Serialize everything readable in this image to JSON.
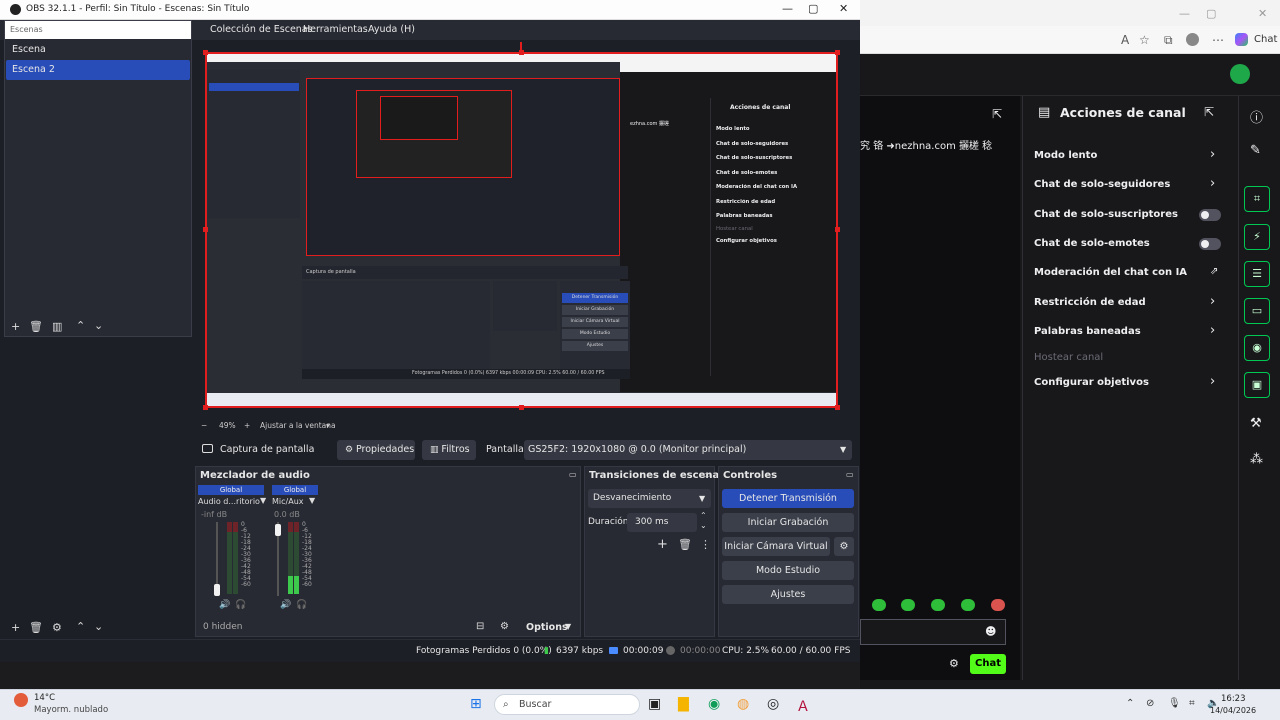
{
  "obs": {
    "title": "OBS 32.1.1 - Perfil: Sin Título - Escenas: Sin Título",
    "menu": [
      "Colección de Escenas",
      "Herramientas",
      "Ayuda (H)"
    ],
    "scenes_header": "Escenas",
    "scenes": [
      "Escena",
      "Escena 2"
    ],
    "zoom_level": "49%",
    "zoom_fit": "Ajustar a la ventana",
    "source_name": "Captura de pantalla",
    "properties_label": "Propiedades",
    "filters_label": "Filtros",
    "display_label": "Pantalla",
    "display_value": "GS25F2: 1920x1080 @ 0.0 (Monitor principal)",
    "mixer": {
      "title": "Mezclador de audio",
      "global_label": "Global",
      "channels": [
        {
          "name": "Audio d...ritorio",
          "db": "-inf dB"
        },
        {
          "name": "Mic/Aux",
          "db": "0.0 dB"
        }
      ],
      "scale": [
        "0",
        "-6",
        "-12",
        "-18",
        "-24",
        "-30",
        "-36",
        "-42",
        "-48",
        "-54",
        "-60"
      ],
      "hidden": "0 hidden",
      "options": "Options"
    },
    "transitions": {
      "title": "Transiciones de escena",
      "type": "Desvanecimiento",
      "duration_label": "Duración",
      "duration_value": "300 ms"
    },
    "controls": {
      "title": "Controles",
      "stop_stream": "Detener Transmisión",
      "start_recording": "Iniciar Grabación",
      "virtual_cam": "Iniciar Cámara Virtual",
      "studio_mode": "Modo Estudio",
      "settings": "Ajustes"
    },
    "status": {
      "dropped_frames": "Fotogramas Perdidos 0 (0.0%)",
      "bitrate": "6397 kbps",
      "stream_time": "00:00:09",
      "rec_time": "00:00:00",
      "cpu": "CPU: 2.5%",
      "fps": "60.00 / 60.00 FPS"
    }
  },
  "preview_mini": {
    "panel_title": "Acciones de canal",
    "items": [
      "Modo lento",
      "Chat de solo-seguidores",
      "Chat de solo-suscriptores",
      "Chat de solo-emotes",
      "Moderación del chat con IA",
      "Restricción de edad",
      "Palabras baneadas",
      "Hostear canal",
      "Configurar objetivos"
    ],
    "sources_label": "Captura de pantalla",
    "controls": [
      "Detener Transmisión",
      "Iniciar Grabación",
      "Iniciar Cámara Virtual",
      "Modo Estudio",
      "Ajustes"
    ],
    "status": "Fotogramas Perdidos 0 (0.0%)   6397 kbps   00:00:09   CPU: 2.5%   60.00 / 60.00 FPS",
    "chat_text": "ezhna.com 攦槎"
  },
  "browser": {
    "chat_label": "Chat",
    "chat_text": "究 铬 ➜nezhna.com 攦槎 稔",
    "chat_button": "Chat",
    "panel_title": "Acciones de canal",
    "items": [
      {
        "label": "Modo lento",
        "control": "arrow"
      },
      {
        "label": "Chat de solo-seguidores",
        "control": "arrow"
      },
      {
        "label": "Chat de solo-suscriptores",
        "control": "toggle"
      },
      {
        "label": "Chat de solo-emotes",
        "control": "toggle"
      },
      {
        "label": "Moderación del chat con IA",
        "control": "external"
      },
      {
        "label": "Restricción de edad",
        "control": "arrow"
      },
      {
        "label": "Palabras baneadas",
        "control": "arrow"
      },
      {
        "label": "Hostear canal",
        "control": "none",
        "disabled": true
      },
      {
        "label": "Configurar objetivos",
        "control": "arrow"
      }
    ]
  },
  "taskbar": {
    "weather_temp": "14°C",
    "weather_desc": "Mayorm. nublado",
    "search_placeholder": "Buscar",
    "time": "16:23",
    "date": "14/04/2026"
  },
  "colors": {
    "obs_bg": "#1d1f26",
    "obs_dock": "#272a33",
    "accent_blue": "#284cb8",
    "selection_red": "#e21d1d",
    "twitch_green": "#53fc18"
  }
}
